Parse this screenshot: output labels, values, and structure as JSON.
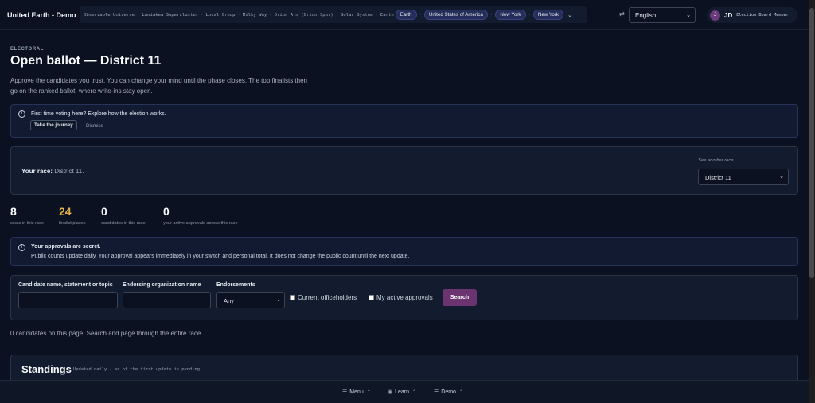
{
  "header": {
    "brand": "United Earth - Demo",
    "breadcrumbs": [
      {
        "label": "Observable Universe",
        "pill": false
      },
      {
        "label": "Laniakea Supercluster",
        "pill": false
      },
      {
        "label": "Local Group",
        "pill": false
      },
      {
        "label": "Milky Way",
        "pill": false
      },
      {
        "label": "Orion Arm (Orion Spur)",
        "pill": false
      },
      {
        "label": "Solar System",
        "pill": false
      },
      {
        "label": "Earth",
        "pill": false
      },
      {
        "label": "Earth",
        "pill": true
      },
      {
        "label": "United States of America",
        "pill": true
      },
      {
        "label": "New York",
        "pill": true
      },
      {
        "label": "New York",
        "pill": true
      }
    ],
    "breadcrumb_separator": "·",
    "language": {
      "selected": "English",
      "icon": "translate-icon"
    },
    "user": {
      "avatar_letter": "J",
      "initials": "JD",
      "role": "Election Board Member"
    }
  },
  "page": {
    "eyebrow": "ELECTORAL",
    "title": "Open ballot — District 11",
    "intro": "Approve the candidates you trust. You can change your mind until the phase closes. The top finalists then go on the ranked ballot, where write-ins stay open."
  },
  "notice": {
    "text": "First time voting here? Explore how the election works.",
    "primary": "Take the journey",
    "secondary": "Dismiss"
  },
  "race": {
    "label": "Your race:",
    "value": "District 11.",
    "other_label": "See another race",
    "selected": "District 11"
  },
  "stats": [
    {
      "value": "8",
      "label": "seats in this race",
      "highlight": false
    },
    {
      "value": "24",
      "label": "finalist places",
      "highlight": true
    },
    {
      "value": "0",
      "label": "candidates in this race",
      "highlight": false
    },
    {
      "value": "0",
      "label": "your active approvals across this race",
      "highlight": false
    }
  ],
  "secret": {
    "title": "Your approvals are secret.",
    "body": "Public counts update daily. Your approval appears immediately in your switch and personal total. It does not change the public count until the next update."
  },
  "filters": {
    "name_label": "Candidate name, statement or topic",
    "name_value": "",
    "org_label": "Endorsing organization name",
    "org_value": "",
    "endorse_label": "Endorsements",
    "endorse_selected": "Any",
    "check_incumbents": "Current officeholders",
    "check_mine": "My active approvals",
    "search_button": "Search"
  },
  "results_note": "0 candidates on this page. Search and page through the entire race.",
  "standings": {
    "title": "Standings",
    "subtitle": "Updated daily - as of the first update is pending"
  },
  "bottom_nav": {
    "menu": "Menu",
    "learn": "Learn",
    "demo": "Demo"
  },
  "colors": {
    "background": "#0b1120",
    "accent": "#6b3370",
    "highlight": "#e4b14a"
  }
}
